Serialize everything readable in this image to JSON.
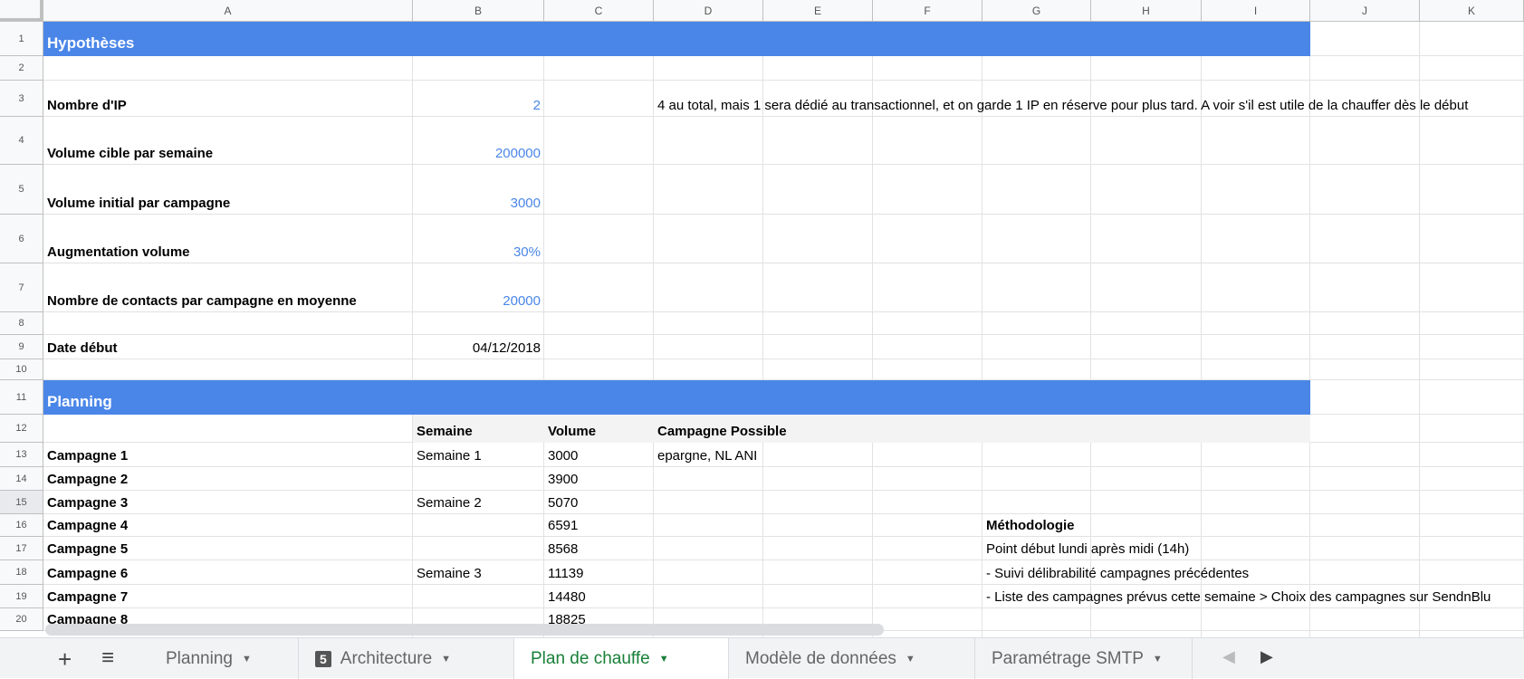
{
  "columns": [
    "A",
    "B",
    "C",
    "D",
    "E",
    "F",
    "G",
    "H",
    "I",
    "J",
    "K"
  ],
  "rows": [
    "1",
    "2",
    "3",
    "4",
    "5",
    "6",
    "7",
    "8",
    "9",
    "10",
    "11",
    "12",
    "13",
    "14",
    "15",
    "16",
    "17",
    "18",
    "19",
    "20"
  ],
  "colors": {
    "band": "#4a86e8",
    "active_tab": "#188038"
  },
  "sheet": {
    "hypotheses_title": "Hypothèses",
    "params": [
      {
        "label": "Nombre d'IP",
        "value": "2"
      },
      {
        "label": "Volume cible par semaine",
        "value": "200000"
      },
      {
        "label": "Volume initial par campagne",
        "value": "3000"
      },
      {
        "label": "Augmentation volume",
        "value": "30%"
      },
      {
        "label": "Nombre de contacts par campagne en moyenne",
        "value": "20000"
      }
    ],
    "ip_note": "4 au total, mais 1 sera dédié au transactionnel, et on garde 1 IP en réserve pour plus tard. A voir s'il est utile de la chauffer dès le début",
    "date_label": "Date début",
    "date_value": "04/12/2018",
    "planning_title": "Planning",
    "planning_headers": [
      "Semaine",
      "Volume",
      "Campagne Possible"
    ],
    "campaigns": [
      {
        "name": "Campagne 1",
        "week": "Semaine 1",
        "volume": "3000",
        "possible": "epargne, NL ANI"
      },
      {
        "name": "Campagne 2",
        "week": "",
        "volume": "3900",
        "possible": ""
      },
      {
        "name": "Campagne 3",
        "week": "Semaine 2",
        "volume": "5070",
        "possible": ""
      },
      {
        "name": "Campagne 4",
        "week": "",
        "volume": "6591",
        "possible": ""
      },
      {
        "name": "Campagne 5",
        "week": "",
        "volume": "8568",
        "possible": ""
      },
      {
        "name": "Campagne 6",
        "week": "Semaine 3",
        "volume": "11139",
        "possible": ""
      },
      {
        "name": "Campagne 7",
        "week": "",
        "volume": "14480",
        "possible": ""
      },
      {
        "name": "Campagne 8",
        "week": "",
        "volume": "18825",
        "possible": ""
      }
    ],
    "methodology": [
      "Méthodologie",
      "Point début lundi après midi (14h)",
      "- Suivi délibrabilité campagnes précédentes",
      "- Liste des campagnes prévus cette semaine > Choix des campagnes sur SendnBlu"
    ]
  },
  "tabs": [
    {
      "label": "Planning",
      "badge": ""
    },
    {
      "label": "Architecture",
      "badge": "5"
    },
    {
      "label": "Plan de chauffe",
      "badge": "",
      "active": true
    },
    {
      "label": "Modèle de données",
      "badge": ""
    },
    {
      "label": "Paramétrage SMTP",
      "badge": ""
    }
  ]
}
